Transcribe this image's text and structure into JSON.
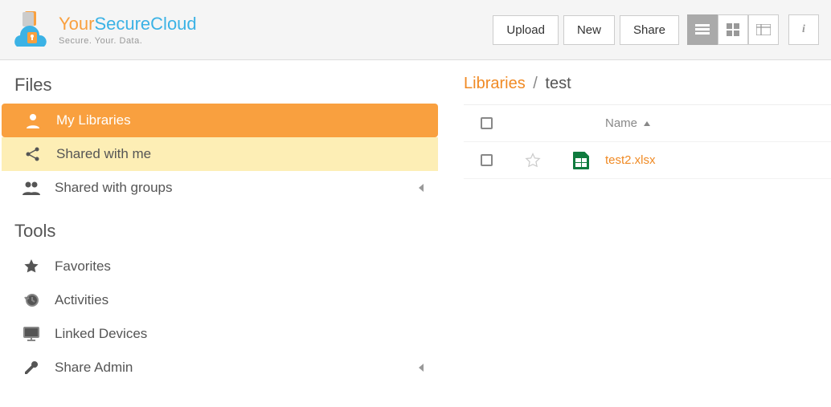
{
  "logo": {
    "t1": "Your",
    "t2": "Secure",
    "t3": "Cloud",
    "tag": "Secure. Your. Data."
  },
  "toolbar": {
    "upload": "Upload",
    "new_": "New",
    "share": "Share"
  },
  "sidebar": {
    "section_files": "Files",
    "section_tools": "Tools",
    "files_items": [
      {
        "label": "My Libraries"
      },
      {
        "label": "Shared with me"
      },
      {
        "label": "Shared with groups"
      }
    ],
    "tools_items": [
      {
        "label": "Favorites"
      },
      {
        "label": "Activities"
      },
      {
        "label": "Linked Devices"
      },
      {
        "label": "Share Admin"
      }
    ]
  },
  "breadcrumb": {
    "root": "Libraries",
    "sep": "/",
    "current": "test"
  },
  "table": {
    "header_name": "Name",
    "rows": [
      {
        "name": "test2.xlsx",
        "type": "spreadsheet"
      }
    ]
  }
}
